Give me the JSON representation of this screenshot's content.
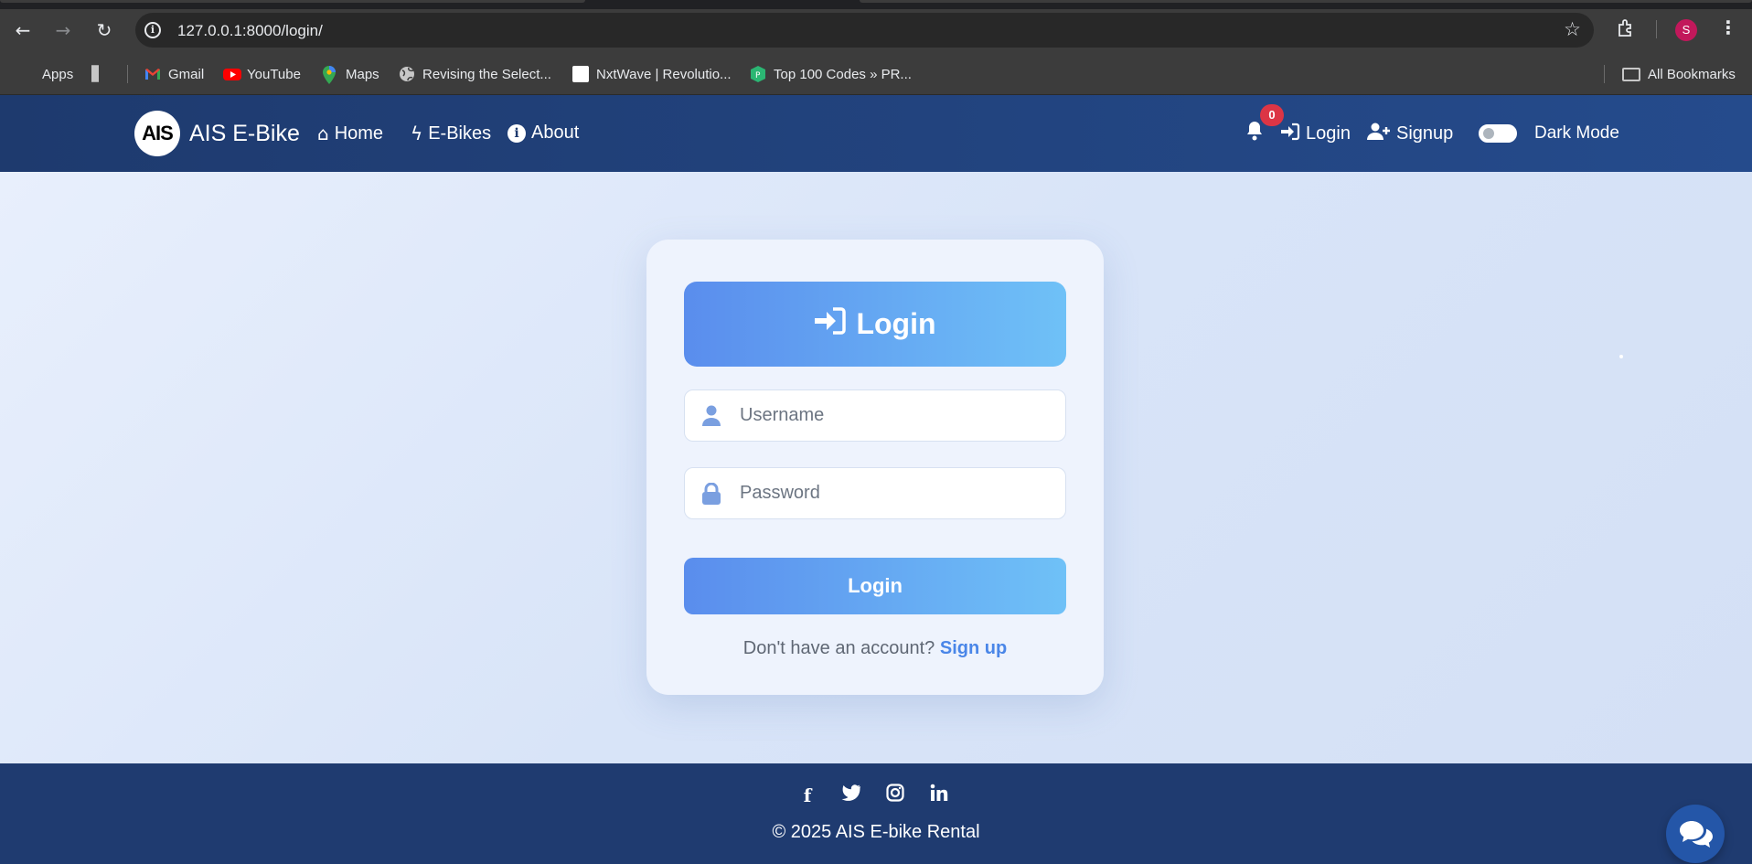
{
  "browser": {
    "url": "127.0.0.1:8000/login/",
    "bookmarks": [
      {
        "label": "Apps",
        "icon": "apps-icon"
      },
      {
        "label": "",
        "icon": "grid-icon"
      },
      {
        "label": "Gmail",
        "icon": "gmail-icon"
      },
      {
        "label": "YouTube",
        "icon": "youtube-icon"
      },
      {
        "label": "Maps",
        "icon": "maps-icon"
      },
      {
        "label": "Revising the Select...",
        "icon": "globe-icon"
      },
      {
        "label": "NxtWave | Revolutio...",
        "icon": "nxtwave-icon"
      },
      {
        "label": "Top 100 Codes » PR...",
        "icon": "codes-icon"
      }
    ],
    "all_bookmarks": "All Bookmarks",
    "profile_initial": "S"
  },
  "navbar": {
    "logo_text": "AIS",
    "brand": "AIS E-Bike",
    "links": {
      "home": "Home",
      "ebikes": "E-Bikes",
      "about": "About"
    },
    "notification_count": "0",
    "login": "Login",
    "signup": "Signup",
    "dark_mode": "Dark Mode",
    "dark_mode_on": false
  },
  "login_card": {
    "title": "Login",
    "username_placeholder": "Username",
    "password_placeholder": "Password",
    "submit_label": "Login",
    "signup_prompt": "Don't have an account?",
    "signup_link": "Sign up"
  },
  "footer": {
    "social": [
      "facebook-icon",
      "twitter-icon",
      "instagram-icon",
      "linkedin-icon"
    ],
    "copyright": "© 2025 AIS E-bike Rental"
  },
  "colors": {
    "navbar": "#1e3a6e",
    "footer": "#1f3b70",
    "accent_start": "#5a8ded",
    "accent_end": "#6fc1f7",
    "badge": "#dc3545"
  }
}
